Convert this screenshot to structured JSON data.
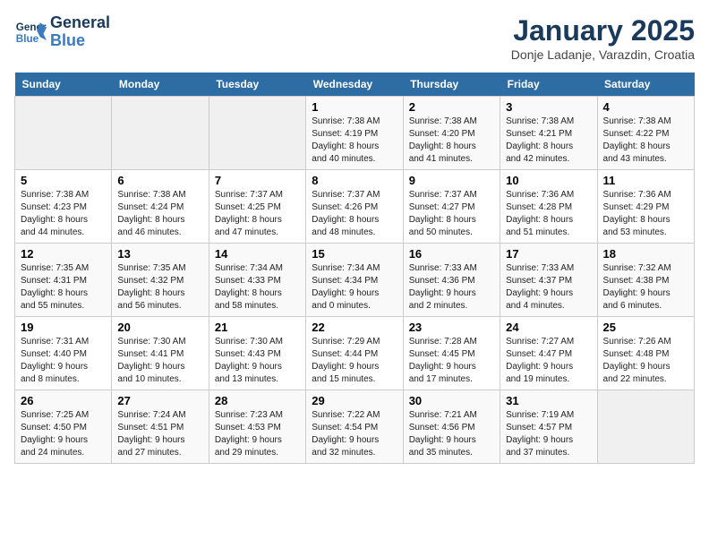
{
  "app": {
    "name": "GeneralBlue",
    "title": "January 2025",
    "subtitle": "Donje Ladanje, Varazdin, Croatia"
  },
  "calendar": {
    "days_of_week": [
      "Sunday",
      "Monday",
      "Tuesday",
      "Wednesday",
      "Thursday",
      "Friday",
      "Saturday"
    ],
    "weeks": [
      [
        {
          "day": "",
          "info": ""
        },
        {
          "day": "",
          "info": ""
        },
        {
          "day": "",
          "info": ""
        },
        {
          "day": "1",
          "info": "Sunrise: 7:38 AM\nSunset: 4:19 PM\nDaylight: 8 hours\nand 40 minutes."
        },
        {
          "day": "2",
          "info": "Sunrise: 7:38 AM\nSunset: 4:20 PM\nDaylight: 8 hours\nand 41 minutes."
        },
        {
          "day": "3",
          "info": "Sunrise: 7:38 AM\nSunset: 4:21 PM\nDaylight: 8 hours\nand 42 minutes."
        },
        {
          "day": "4",
          "info": "Sunrise: 7:38 AM\nSunset: 4:22 PM\nDaylight: 8 hours\nand 43 minutes."
        }
      ],
      [
        {
          "day": "5",
          "info": "Sunrise: 7:38 AM\nSunset: 4:23 PM\nDaylight: 8 hours\nand 44 minutes."
        },
        {
          "day": "6",
          "info": "Sunrise: 7:38 AM\nSunset: 4:24 PM\nDaylight: 8 hours\nand 46 minutes."
        },
        {
          "day": "7",
          "info": "Sunrise: 7:37 AM\nSunset: 4:25 PM\nDaylight: 8 hours\nand 47 minutes."
        },
        {
          "day": "8",
          "info": "Sunrise: 7:37 AM\nSunset: 4:26 PM\nDaylight: 8 hours\nand 48 minutes."
        },
        {
          "day": "9",
          "info": "Sunrise: 7:37 AM\nSunset: 4:27 PM\nDaylight: 8 hours\nand 50 minutes."
        },
        {
          "day": "10",
          "info": "Sunrise: 7:36 AM\nSunset: 4:28 PM\nDaylight: 8 hours\nand 51 minutes."
        },
        {
          "day": "11",
          "info": "Sunrise: 7:36 AM\nSunset: 4:29 PM\nDaylight: 8 hours\nand 53 minutes."
        }
      ],
      [
        {
          "day": "12",
          "info": "Sunrise: 7:35 AM\nSunset: 4:31 PM\nDaylight: 8 hours\nand 55 minutes."
        },
        {
          "day": "13",
          "info": "Sunrise: 7:35 AM\nSunset: 4:32 PM\nDaylight: 8 hours\nand 56 minutes."
        },
        {
          "day": "14",
          "info": "Sunrise: 7:34 AM\nSunset: 4:33 PM\nDaylight: 8 hours\nand 58 minutes."
        },
        {
          "day": "15",
          "info": "Sunrise: 7:34 AM\nSunset: 4:34 PM\nDaylight: 9 hours\nand 0 minutes."
        },
        {
          "day": "16",
          "info": "Sunrise: 7:33 AM\nSunset: 4:36 PM\nDaylight: 9 hours\nand 2 minutes."
        },
        {
          "day": "17",
          "info": "Sunrise: 7:33 AM\nSunset: 4:37 PM\nDaylight: 9 hours\nand 4 minutes."
        },
        {
          "day": "18",
          "info": "Sunrise: 7:32 AM\nSunset: 4:38 PM\nDaylight: 9 hours\nand 6 minutes."
        }
      ],
      [
        {
          "day": "19",
          "info": "Sunrise: 7:31 AM\nSunset: 4:40 PM\nDaylight: 9 hours\nand 8 minutes."
        },
        {
          "day": "20",
          "info": "Sunrise: 7:30 AM\nSunset: 4:41 PM\nDaylight: 9 hours\nand 10 minutes."
        },
        {
          "day": "21",
          "info": "Sunrise: 7:30 AM\nSunset: 4:43 PM\nDaylight: 9 hours\nand 13 minutes."
        },
        {
          "day": "22",
          "info": "Sunrise: 7:29 AM\nSunset: 4:44 PM\nDaylight: 9 hours\nand 15 minutes."
        },
        {
          "day": "23",
          "info": "Sunrise: 7:28 AM\nSunset: 4:45 PM\nDaylight: 9 hours\nand 17 minutes."
        },
        {
          "day": "24",
          "info": "Sunrise: 7:27 AM\nSunset: 4:47 PM\nDaylight: 9 hours\nand 19 minutes."
        },
        {
          "day": "25",
          "info": "Sunrise: 7:26 AM\nSunset: 4:48 PM\nDaylight: 9 hours\nand 22 minutes."
        }
      ],
      [
        {
          "day": "26",
          "info": "Sunrise: 7:25 AM\nSunset: 4:50 PM\nDaylight: 9 hours\nand 24 minutes."
        },
        {
          "day": "27",
          "info": "Sunrise: 7:24 AM\nSunset: 4:51 PM\nDaylight: 9 hours\nand 27 minutes."
        },
        {
          "day": "28",
          "info": "Sunrise: 7:23 AM\nSunset: 4:53 PM\nDaylight: 9 hours\nand 29 minutes."
        },
        {
          "day": "29",
          "info": "Sunrise: 7:22 AM\nSunset: 4:54 PM\nDaylight: 9 hours\nand 32 minutes."
        },
        {
          "day": "30",
          "info": "Sunrise: 7:21 AM\nSunset: 4:56 PM\nDaylight: 9 hours\nand 35 minutes."
        },
        {
          "day": "31",
          "info": "Sunrise: 7:19 AM\nSunset: 4:57 PM\nDaylight: 9 hours\nand 37 minutes."
        },
        {
          "day": "",
          "info": ""
        }
      ]
    ]
  }
}
